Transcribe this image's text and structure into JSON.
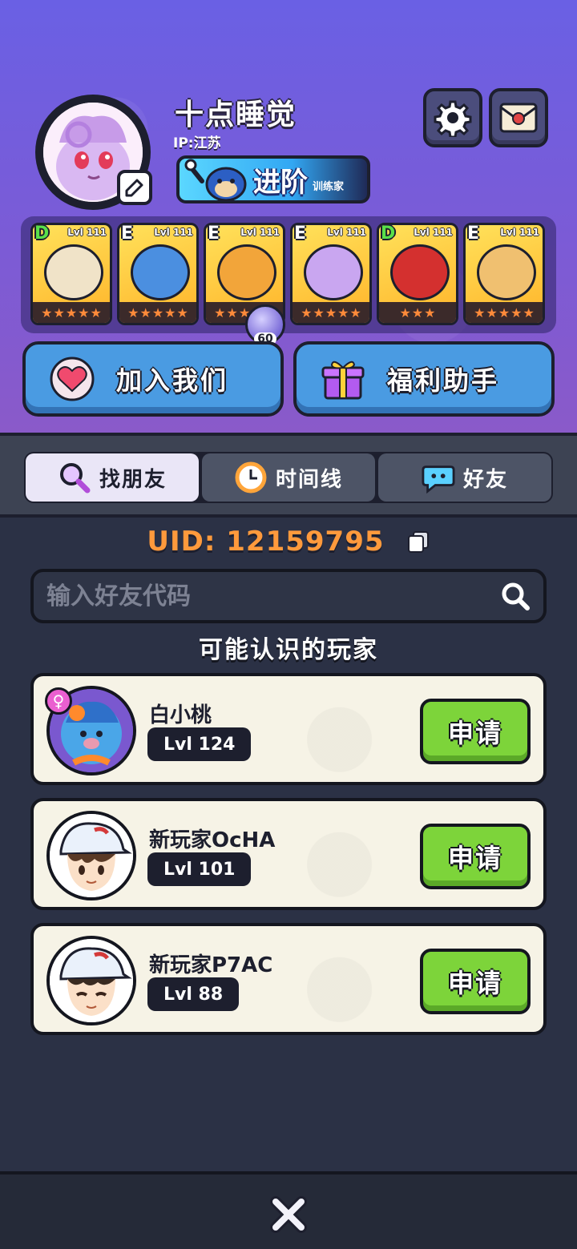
{
  "profile": {
    "name": "十点睡觉",
    "ip": "IP:江苏",
    "advance_label": "进阶",
    "advance_sub": "训练家"
  },
  "team": [
    {
      "grade": "D",
      "level": "Lvl 111",
      "stars": 5,
      "color": "#f0e3c8"
    },
    {
      "grade": "E",
      "level": "Lvl 111",
      "stars": 5,
      "color": "#4b8fe0"
    },
    {
      "grade": "E",
      "level": "Lvl 111",
      "stars": 5,
      "color": "#f2a53a"
    },
    {
      "grade": "E",
      "level": "Lvl 111",
      "stars": 5,
      "color": "#c9a6f0"
    },
    {
      "grade": "D",
      "level": "Lvl 111",
      "stars": 3,
      "color": "#d4302f"
    },
    {
      "grade": "E",
      "level": "Lvl 111",
      "stars": 5,
      "color": "#f0c070"
    }
  ],
  "gem_count": "60",
  "buttons": {
    "join": "加入我们",
    "welfare": "福利助手"
  },
  "tabs": [
    {
      "label": "找朋友",
      "icon": "magnifier-icon"
    },
    {
      "label": "时间线",
      "icon": "clock-icon"
    },
    {
      "label": "好友",
      "icon": "chat-face-icon"
    }
  ],
  "uid": "UID:  12159795",
  "search": {
    "placeholder": "输入好友代码"
  },
  "suggest_title": "可能认识的玩家",
  "players": [
    {
      "name": "白小桃",
      "level": "Lvl 124",
      "apply": "申请"
    },
    {
      "name": "新玩家OcHA",
      "level": "Lvl 101",
      "apply": "申请"
    },
    {
      "name": "新玩家P7AC",
      "level": "Lvl 88",
      "apply": "申请"
    }
  ],
  "colors": {
    "accent_orange": "#ff9a3c",
    "apply_green": "#7dd43a",
    "primary_blue": "#4a9be2",
    "header_purple": "#6a60e4"
  }
}
